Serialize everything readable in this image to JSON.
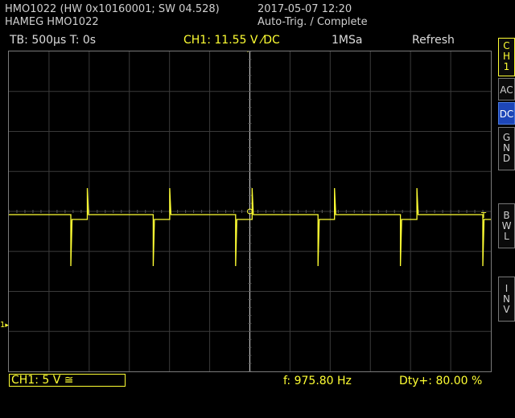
{
  "header": {
    "device_line1": "HMO1022 (HW 0x10160001; SW 04.528)",
    "device_line2": "HAMEG HMO1022",
    "datetime": "2017-05-07 12:20",
    "trigger_status": "Auto-Trig. / Complete"
  },
  "status_bar": {
    "timebase": "TB: 500µs   T: 0s",
    "channel_setting": "CH1: 11.55 V ⁄DC",
    "sample_rate": "1MSa",
    "mode": "Refresh"
  },
  "side_panel": {
    "channel": [
      "C",
      "H",
      "1"
    ],
    "ac": "AC",
    "dc": "DC",
    "gnd": [
      "G",
      "N",
      "D"
    ],
    "bwl": [
      "B",
      "W",
      "L"
    ],
    "inv": [
      "I",
      "N",
      "V"
    ]
  },
  "bottom_bar": {
    "channel_scale": "CH1: 5 V ≅",
    "frequency": "f: 975.80 Hz",
    "duty": "Dty+: 80.00 %"
  },
  "colors": {
    "trace": "#ffff33",
    "grid": "#3a3a3a",
    "background": "#000000",
    "dc_active": "#1d46b8"
  },
  "waveform": {
    "channel": "CH1",
    "frequency_hz": 975.8,
    "duty_percent": 80.0,
    "cycles_shown": 6
  }
}
